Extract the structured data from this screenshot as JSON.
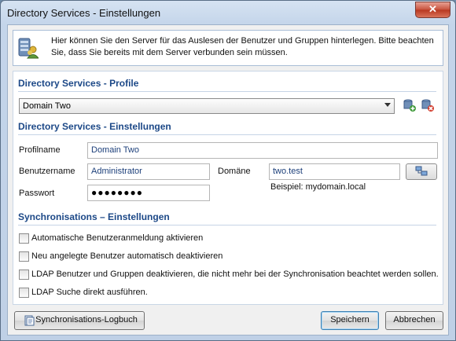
{
  "window": {
    "title": "Directory Services - Einstellungen",
    "close_label": "✕"
  },
  "info": {
    "text": "Hier können Sie den Server für das Auslesen der Benutzer und Gruppen hinterlegen. Bitte beachten Sie, dass Sie bereits mit dem Server verbunden sein müssen."
  },
  "profile_section": {
    "title": "Directory Services - Profile",
    "selected_profile": "Domain Two"
  },
  "settings_section": {
    "title": "Directory Services - Einstellungen",
    "profile_name_label": "Profilname",
    "profile_name_value": "Domain Two",
    "username_label": "Benutzername",
    "username_value": "Administrator",
    "domain_label": "Domäne",
    "domain_value": "two.test",
    "domain_example": "Beispiel: mydomain.local",
    "password_label": "Passwort",
    "password_value": "●●●●●●●●"
  },
  "sync_section": {
    "title": "Synchronisations – Einstellungen",
    "options": [
      {
        "label": "Automatische Benutzeranmeldung aktivieren",
        "checked": false
      },
      {
        "label": "Neu angelegte Benutzer automatisch deaktivieren",
        "checked": false
      },
      {
        "label": "LDAP Benutzer und Gruppen deaktivieren, die nicht mehr bei der Synchronisation beachtet werden sollen.",
        "checked": false
      },
      {
        "label": "LDAP Suche direkt ausführen.",
        "checked": false
      }
    ]
  },
  "buttons": {
    "log": "Synchronisations-Logbuch",
    "save": "Speichern",
    "cancel": "Abbrechen"
  }
}
